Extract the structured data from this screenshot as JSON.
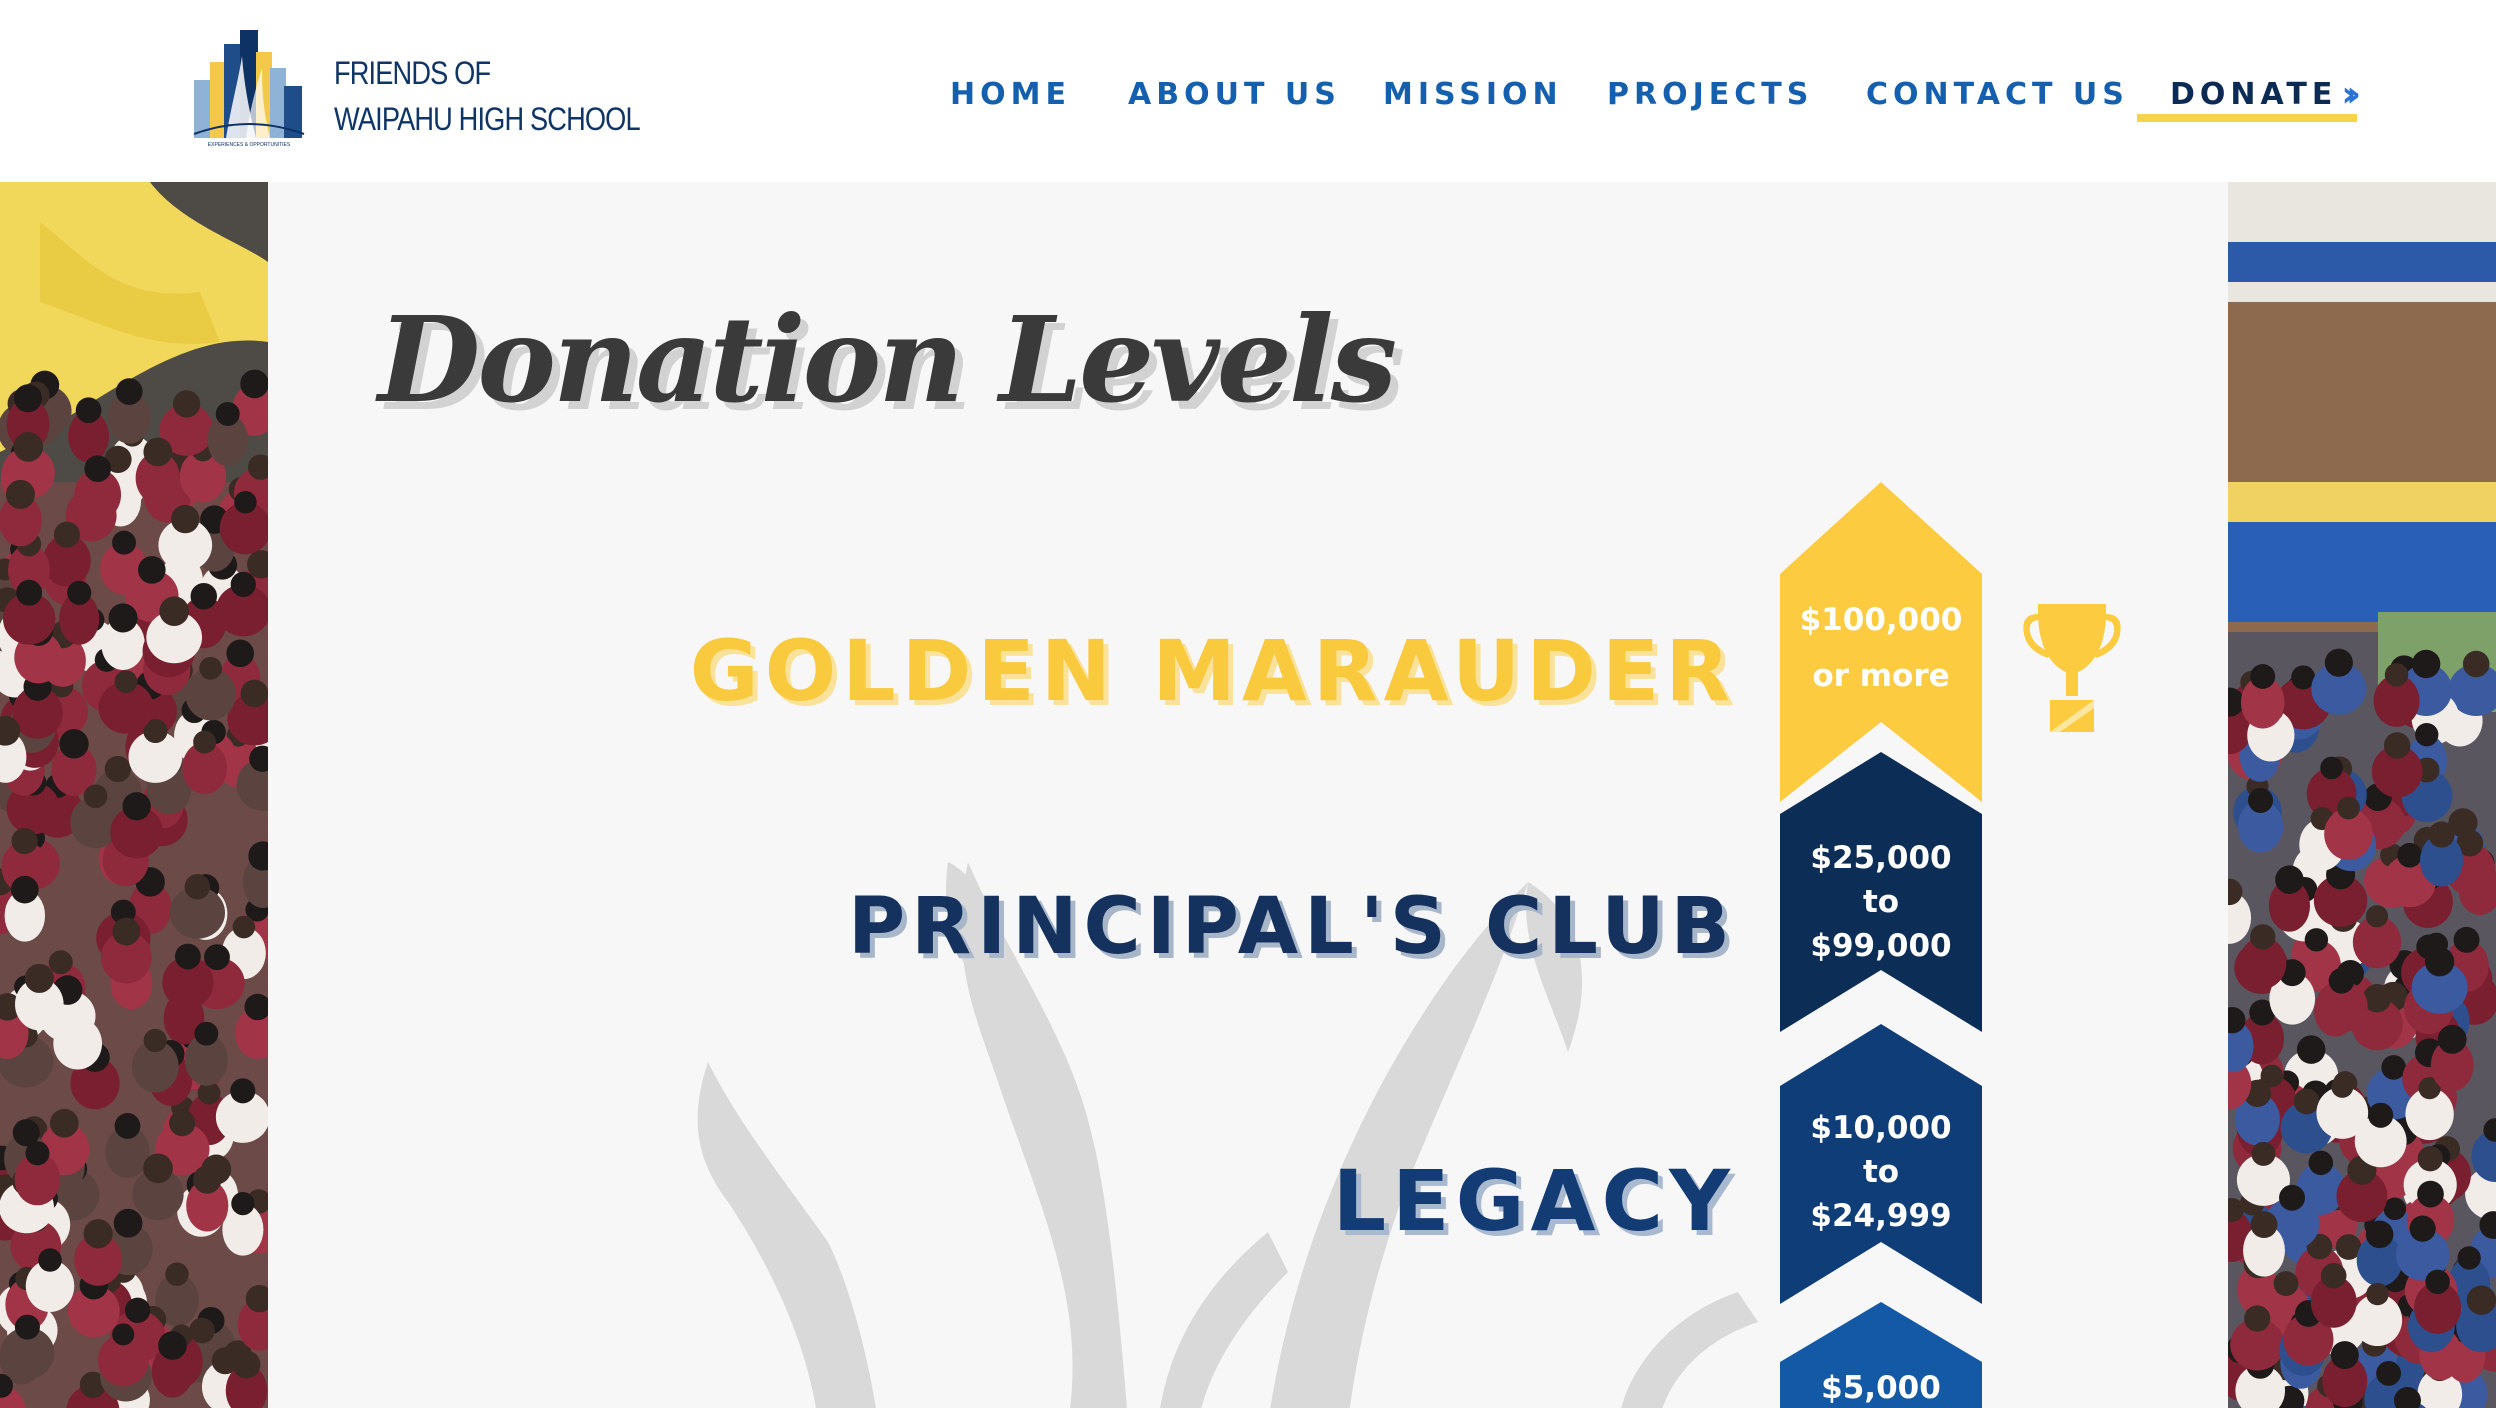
{
  "brand": {
    "line1": "FRIENDS OF",
    "line2": "WAIPAHU HIGH SCHOOL",
    "seal_text": "EXPERIENCES & OPPORTUNITIES"
  },
  "nav": {
    "items": [
      {
        "label": "HOME"
      },
      {
        "label": "ABOUT US"
      },
      {
        "label": "MISSION"
      },
      {
        "label": "PROJECTS"
      },
      {
        "label": "CONTACT US"
      },
      {
        "label": "DONATE"
      }
    ],
    "active": "DONATE"
  },
  "page": {
    "title": "Donation Levels"
  },
  "levels": [
    {
      "name": "GOLDEN MARAUDER",
      "line1": "$100,000",
      "line2": "or more",
      "line3": "",
      "color": "#fdcb3f"
    },
    {
      "name": "PRINCIPAL'S CLUB",
      "line1": "$25,000",
      "line2": "to",
      "line3": "$99,000",
      "color": "#0c2d56"
    },
    {
      "name": "LEGACY",
      "line1": "$10,000",
      "line2": "to",
      "line3": "$24,999",
      "color": "#0f3d78"
    },
    {
      "name": "",
      "line1": "$5,000",
      "line2": "",
      "line3": "",
      "color": "#1359a6"
    }
  ],
  "icons": {
    "trophy": "trophy-icon",
    "donate_arrow": "double-chevron-right-icon"
  },
  "colors": {
    "gold": "#fdcb3f",
    "navy": "#0c2d56",
    "blue": "#1560ae",
    "panel_bg": "#f7f7f7"
  }
}
